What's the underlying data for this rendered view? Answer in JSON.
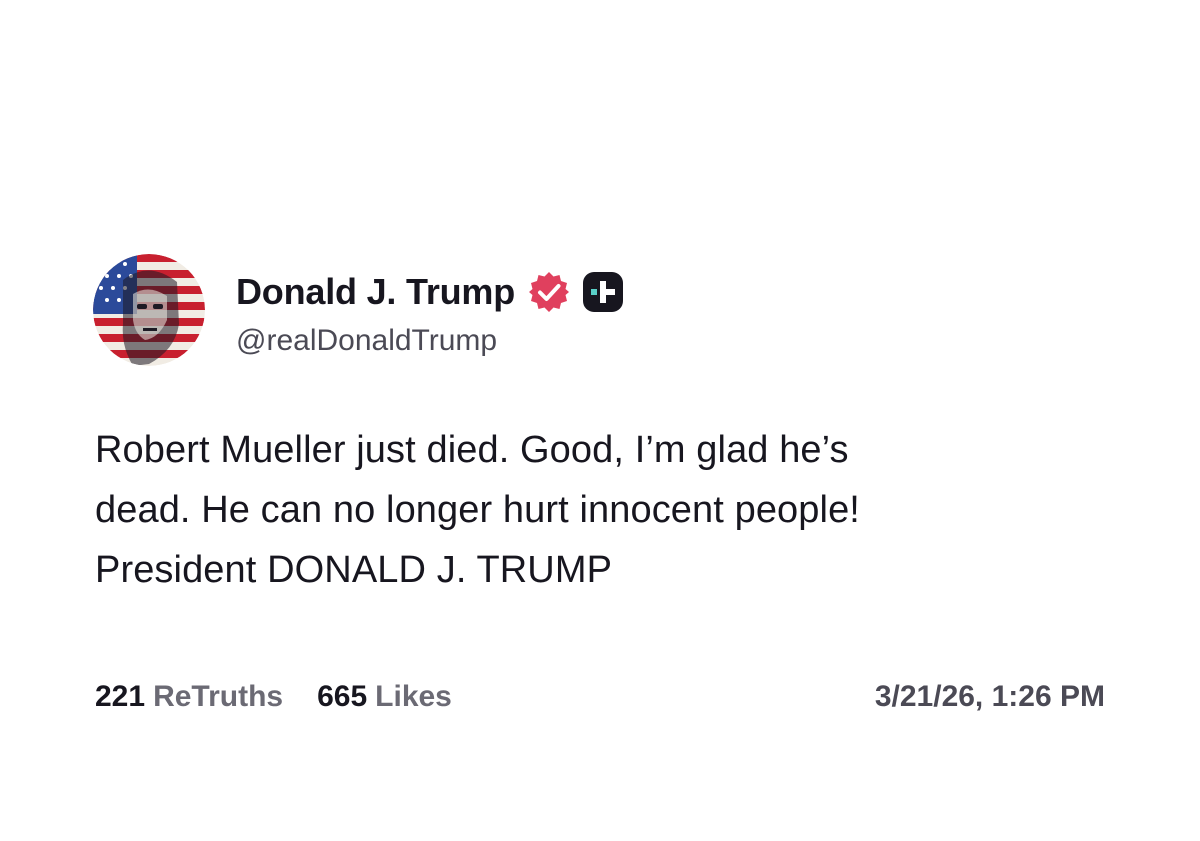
{
  "post": {
    "author": {
      "display_name": "Donald J. Trump",
      "handle": "@realDonaldTrump",
      "avatar_icon": "flag-portrait-avatar",
      "verified_icon": "verified-badge-icon",
      "plus_icon": "truth-plus-icon"
    },
    "body": {
      "lines": [
        "Robert Mueller just died. Good, I’m glad he’s",
        "dead. He can no longer hurt innocent people!",
        "President DONALD J. TRUMP"
      ]
    },
    "stats": {
      "retruths_count": "221",
      "retruths_label": "ReTruths",
      "likes_count": "665",
      "likes_label": "Likes"
    },
    "timestamp": "3/21/26, 1:26 PM"
  },
  "colors": {
    "verified_badge": "#e0405e",
    "text_primary": "#17161f",
    "text_secondary": "#4b4a55",
    "plus_badge_bg": "#17161f",
    "plus_badge_accent": "#5ad0c8"
  }
}
